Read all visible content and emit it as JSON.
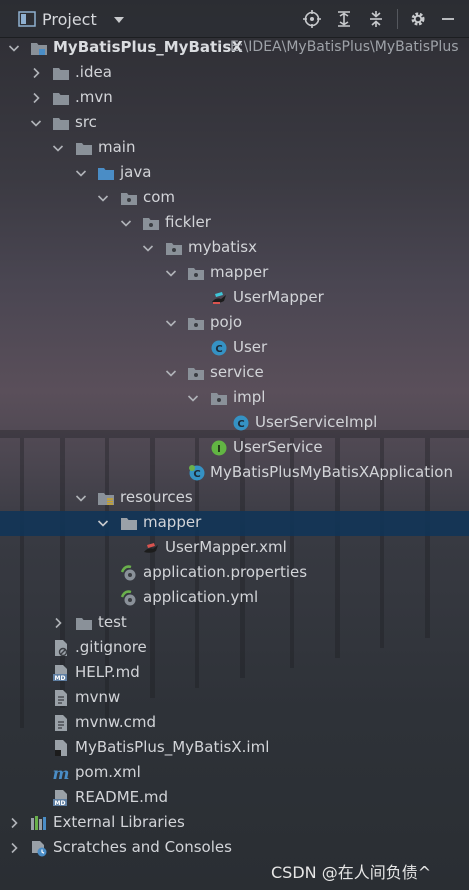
{
  "header": {
    "title": "Project",
    "icons": [
      "project-view-icon",
      "chevron-down-icon",
      "locate-icon",
      "expand-all-icon",
      "collapse-all-icon",
      "gear-icon",
      "minimize-icon"
    ]
  },
  "tree": {
    "root": {
      "label": "MyBatisPlus_MyBatisX",
      "path": "E:\\IDEA\\MyBatisPlus\\MyBatisPlus"
    },
    "idea": "idea",
    "mvn": ".mvn",
    "src": "src",
    "main": "main",
    "java": "java",
    "com": "com",
    "fickler": "fickler",
    "mybatisx": "mybatisx",
    "mapper": "mapper",
    "user_mapper": "UserMapper",
    "pojo": "pojo",
    "user": "User",
    "service": "service",
    "impl": "impl",
    "user_service_impl": "UserServiceImpl",
    "user_service": "UserService",
    "application": "MyBatisPlusMyBatisXApplication",
    "resources": "resources",
    "res_mapper": "mapper",
    "user_mapper_xml": "UserMapper.xml",
    "app_properties": "application.properties",
    "app_yml": "application.yml",
    "test": "test",
    "gitignore": ".gitignore",
    "help": "HELP.md",
    "mvnw": "mvnw",
    "mvnw_cmd": "mvnw.cmd",
    "iml": "MyBatisPlus_MyBatisX.iml",
    "pom": "pom.xml",
    "readme": "README.md",
    "external_libraries": "External Libraries",
    "scratches": "Scratches and Consoles"
  },
  "watermark": "CSDN @在人间负债^",
  "colors": {
    "folder": "#8a9199",
    "java_folder": "#4a8dc6",
    "class_icon": "#3592c4",
    "interface_icon": "#62b543",
    "selection": "#103458"
  }
}
